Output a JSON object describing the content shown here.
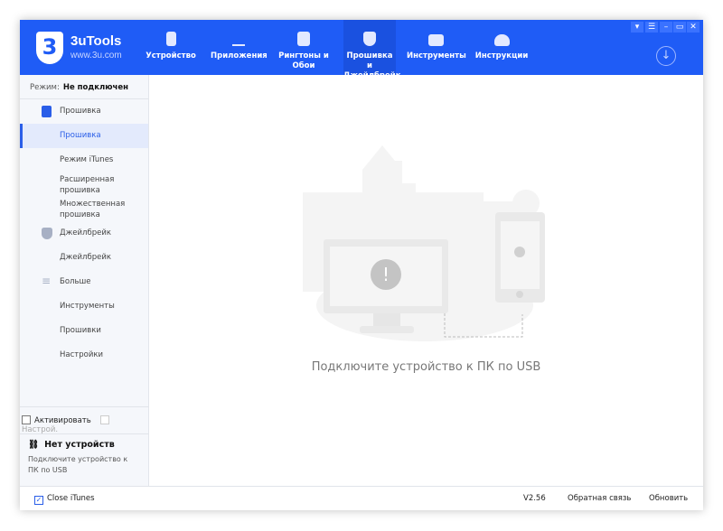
{
  "app": {
    "name": "3uTools",
    "site": "www.3u.com",
    "logo_text": "3"
  },
  "tabs": [
    {
      "label": "Устройство",
      "icon": "phone-icon"
    },
    {
      "label": "Приложения",
      "icon": "app-store-icon"
    },
    {
      "label": "Рингтоны и Обои",
      "icon": "music-icon"
    },
    {
      "label": "Прошивка и Джейлбрейк",
      "icon": "shield-key-icon",
      "active": true
    },
    {
      "label": "Инструменты",
      "icon": "toolbox-icon"
    },
    {
      "label": "Инструкции",
      "icon": "graduation-cap-icon"
    }
  ],
  "window_controls": [
    "shirt-icon",
    "list-icon",
    "minimize-icon",
    "maximize-icon",
    "close-icon"
  ],
  "sidebar": {
    "mode_label": "Режим:",
    "mode_value": "Не подключен",
    "items": [
      {
        "label": "Прошивка",
        "type": "group",
        "icon": "flash-phone-icon"
      },
      {
        "label": "Прошивка",
        "type": "sub",
        "selected": true
      },
      {
        "label": "Режим iTunes",
        "type": "sub"
      },
      {
        "label": "Расширенная прошивка",
        "type": "sub"
      },
      {
        "label": "Множественная прошивка",
        "type": "sub"
      },
      {
        "label": "Джейлбрейк",
        "type": "group",
        "icon": "shield-icon"
      },
      {
        "label": "Джейлбрейк",
        "type": "sub"
      },
      {
        "label": "Больше",
        "type": "group",
        "icon": "menu-icon"
      },
      {
        "label": "Инструменты",
        "type": "sub"
      },
      {
        "label": "Прошивки",
        "type": "sub"
      },
      {
        "label": "Настройки",
        "type": "sub"
      }
    ],
    "activate_label": "Активировать",
    "settings_label": "Настрой.",
    "no_device_title": "Нет устройств",
    "no_device_desc": "Подключите устройство к ПК по USB"
  },
  "main": {
    "message": "Подключите устройство к ПК по USB"
  },
  "footer": {
    "close_itunes": "Close iTunes",
    "close_itunes_checked": true,
    "version": "V2.56",
    "feedback": "Обратная связь",
    "update": "Обновить"
  },
  "colors": {
    "accent": "#1f5cf6",
    "selected_bg": "#e3eafc"
  }
}
